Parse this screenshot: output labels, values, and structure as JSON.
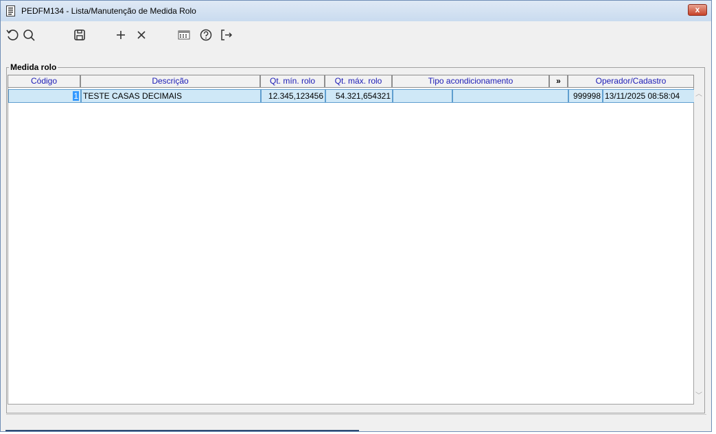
{
  "window": {
    "title": "PEDFM134 - Lista/Manutenção de Medida Rolo",
    "close_label": "x"
  },
  "toolbar": {
    "icons": [
      "refresh-icon",
      "search-icon",
      "save-icon",
      "add-icon",
      "delete-icon",
      "calculator-icon",
      "help-icon",
      "exit-icon"
    ]
  },
  "group": {
    "title": "Medida rolo"
  },
  "grid": {
    "columns": [
      "Código",
      "Descrição",
      "Qt. mín. rolo",
      "Qt. máx. rolo",
      "Tipo acondicionamento",
      "»",
      "Operador/Cadastro"
    ],
    "rows": [
      {
        "codigo": "1",
        "descricao": "TESTE CASAS DECIMAIS",
        "qt_min": "12.345,123456",
        "qt_max": "54.321,654321",
        "tipo_a": "",
        "tipo_b": "",
        "operador": "999998",
        "cadastro": "13/11/2025 08:58:04"
      }
    ]
  },
  "colors": {
    "selected_row": "#cfe8f7",
    "header_text": "#1a1ab5",
    "cursor": "#3399ff"
  }
}
